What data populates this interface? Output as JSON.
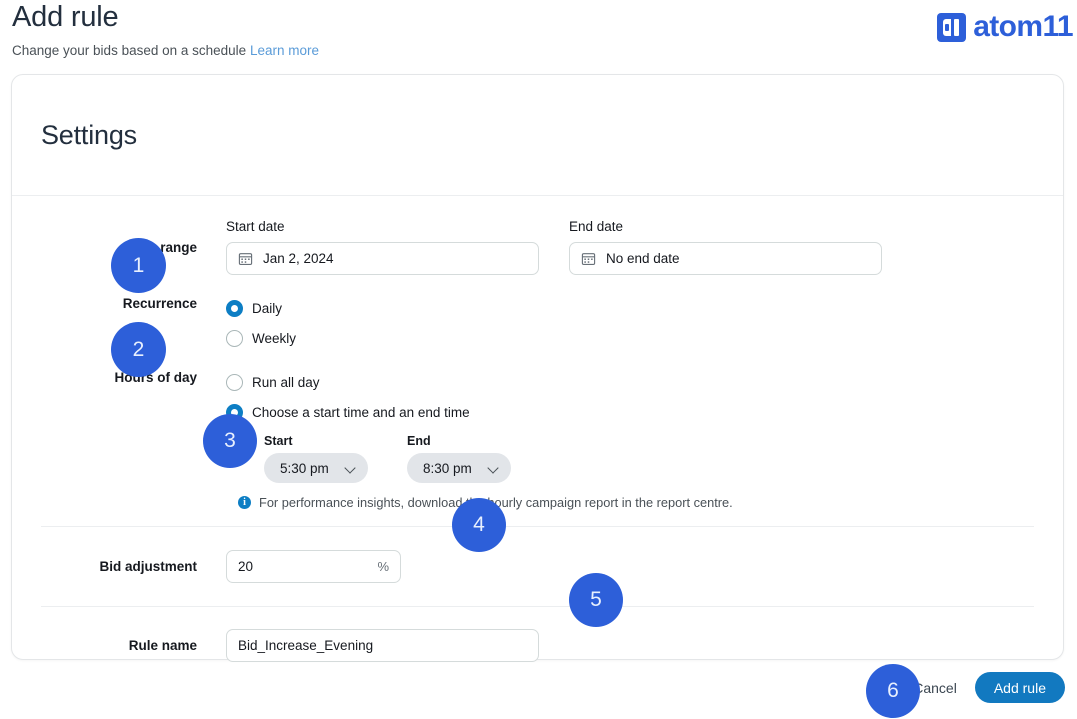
{
  "header": {
    "title": "Add rule",
    "subtitle": "Change your bids based on a schedule",
    "learn_more": "Learn more"
  },
  "brand": {
    "name": "atom11",
    "mark_color": "#2d5fd9",
    "text_color": "#2d5fd9"
  },
  "card": {
    "section_title": "Settings"
  },
  "date_range": {
    "label": "Date range",
    "start": {
      "field_label": "Start date",
      "value": "Jan 2, 2024",
      "icon": "calendar-icon"
    },
    "end": {
      "field_label": "End date",
      "value": "No end date",
      "icon": "calendar-icon"
    }
  },
  "recurrence": {
    "label": "Recurrence",
    "options": [
      {
        "label": "Daily",
        "selected": true
      },
      {
        "label": "Weekly",
        "selected": false
      }
    ]
  },
  "hours_of_day": {
    "label": "Hours of day",
    "options": [
      {
        "label": "Run all day",
        "selected": false
      },
      {
        "label": "Choose a start time and an end time",
        "selected": true
      }
    ],
    "start": {
      "label": "Start",
      "value": "5:30 pm"
    },
    "end": {
      "label": "End",
      "value": "8:30 pm"
    },
    "hint": "For performance insights, download the hourly campaign report in the report centre.",
    "hint_icon": "info-icon"
  },
  "bid_adjustment": {
    "label": "Bid adjustment",
    "value": "20",
    "suffix": "%"
  },
  "rule_name": {
    "label": "Rule name",
    "value": "Bid_Increase_Evening"
  },
  "footer": {
    "cancel_label": "Cancel",
    "submit_label": "Add rule",
    "submit_color": "#1279c0"
  },
  "badges": [
    {
      "n": "1"
    },
    {
      "n": "2"
    },
    {
      "n": "3"
    },
    {
      "n": "4"
    },
    {
      "n": "5"
    },
    {
      "n": "6"
    }
  ],
  "colors": {
    "accent_badge": "#2d5fd9",
    "radio_selected": "#0d7ec4",
    "link": "#5a9bd8"
  }
}
